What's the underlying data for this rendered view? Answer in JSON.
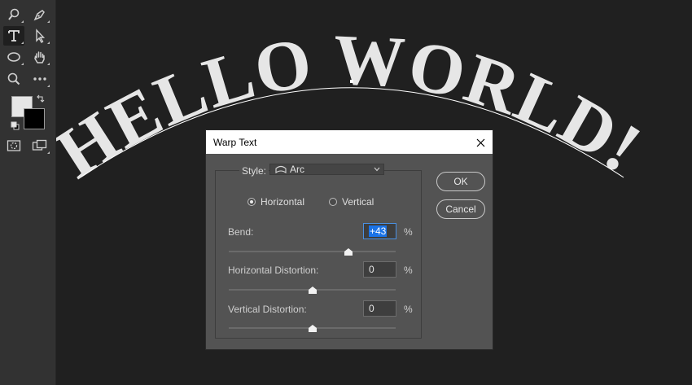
{
  "canvas": {
    "art_text": "HELLO WORLD!"
  },
  "toolbar": {
    "tools": [
      {
        "name": "quick-selection-icon"
      },
      {
        "name": "pen-icon"
      },
      {
        "name": "type-icon",
        "active": true
      },
      {
        "name": "path-selection-icon"
      },
      {
        "name": "ellipse-icon"
      },
      {
        "name": "hand-icon"
      },
      {
        "name": "zoom-icon"
      },
      {
        "name": "more-icon"
      }
    ],
    "colors": {
      "foreground": "#e6e6e6",
      "background": "#000000"
    }
  },
  "dialog": {
    "title": "Warp Text",
    "style_label": "Style:",
    "style_value": "Arc",
    "orientation": {
      "horizontal_label": "Horizontal",
      "vertical_label": "Vertical",
      "selected": "horizontal"
    },
    "bend": {
      "label": "Bend:",
      "value": "+43",
      "unit": "%",
      "slider_percent": 43
    },
    "horizontal_distortion": {
      "label": "Horizontal Distortion:",
      "value": "0",
      "unit": "%",
      "slider_percent": 0
    },
    "vertical_distortion": {
      "label": "Vertical Distortion:",
      "value": "0",
      "unit": "%",
      "slider_percent": 0
    },
    "ok_label": "OK",
    "cancel_label": "Cancel"
  },
  "colors": {
    "accent": "#1a73e8",
    "dialog_bg": "#535353",
    "canvas_bg": "#202020"
  }
}
